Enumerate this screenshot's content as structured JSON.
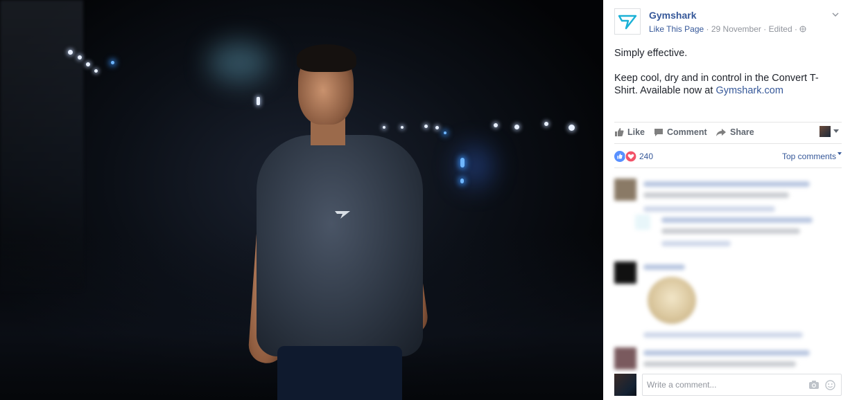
{
  "photo": {
    "alt": ""
  },
  "post": {
    "page_name": "Gymshark",
    "like_page": "Like This Page",
    "sep1": "·",
    "date": "29 November",
    "sep2": "·",
    "edited": "Edited",
    "sep3": "·",
    "text_line1": "Simply effective.",
    "text_line2": "Keep cool, dry and in control in the Convert T-Shirt. Available now at ",
    "text_link": "Gymshark.com"
  },
  "actions": {
    "like": "Like",
    "comment": "Comment",
    "share": "Share"
  },
  "reactions": {
    "count": "240",
    "sort_label": "Top comments"
  },
  "composer": {
    "placeholder": "Write a comment..."
  },
  "colors": {
    "link": "#365899",
    "like_blue": "#5890ff",
    "love_red": "#f25268",
    "brand_teal": "#1bb1d6"
  },
  "icons": [
    "gymshark-logo-icon",
    "chevron-down-icon",
    "globe-icon",
    "thumbs-up-icon",
    "comment-icon",
    "share-icon",
    "caret-down-icon",
    "like-reaction-icon",
    "love-reaction-icon",
    "camera-icon",
    "emoji-icon"
  ]
}
